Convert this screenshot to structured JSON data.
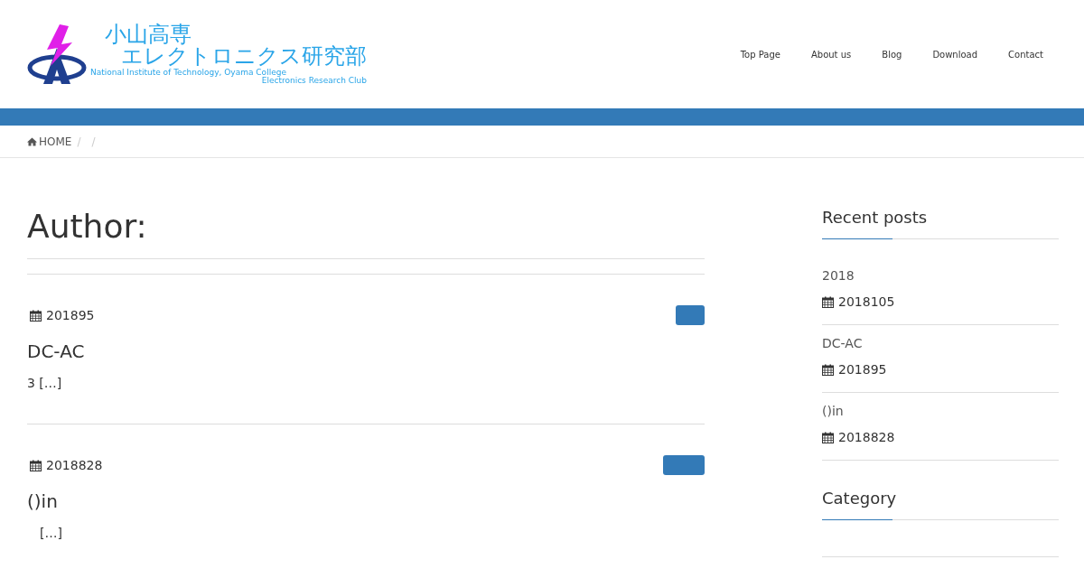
{
  "logo": {
    "line_1": "小山高専",
    "line_2": "エレクトロニクス研究部",
    "line_3": "National Institute of Technology, Oyama College",
    "line_4": "Electronics Research Club"
  },
  "nav": [
    {
      "label": "Top Page"
    },
    {
      "label": "About us"
    },
    {
      "label": "Blog"
    },
    {
      "label": "Download"
    },
    {
      "label": "Contact"
    }
  ],
  "breadcrumb": {
    "home": "HOME",
    "separators": [
      "/",
      "/"
    ]
  },
  "page_title": "Author:",
  "posts": [
    {
      "date": "201895",
      "title": "DC-AC",
      "excerpt": "3 […]"
    },
    {
      "date": "2018828",
      "title": "()in",
      "excerpt": "　[…]"
    }
  ],
  "sidebar": {
    "recent_title": "Recent posts",
    "recent": [
      {
        "title": "2018",
        "date": "2018105"
      },
      {
        "title": "DC-AC",
        "date": "201895"
      },
      {
        "title": "()in",
        "date": "2018828"
      }
    ],
    "category_title": "Category"
  }
}
